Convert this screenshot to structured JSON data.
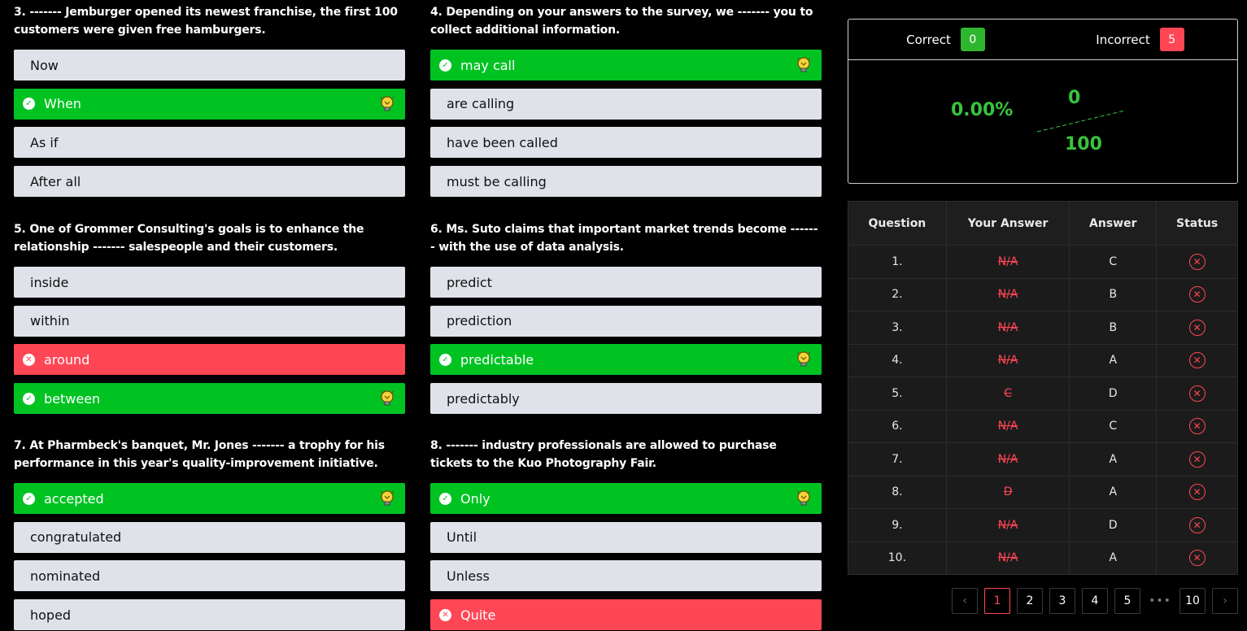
{
  "questions": [
    {
      "text": "3. ------- Jemburger opened its newest franchise, the first 100 customers were given free hamburgers.",
      "options": [
        {
          "label": "Now",
          "state": "normal",
          "hint": false
        },
        {
          "label": "When",
          "state": "correct",
          "hint": true
        },
        {
          "label": "As if",
          "state": "normal",
          "hint": false
        },
        {
          "label": "After all",
          "state": "normal",
          "hint": false
        }
      ]
    },
    {
      "text": "4. Depending on your answers to the survey, we ------- you to collect additional information.",
      "options": [
        {
          "label": "may call",
          "state": "correct",
          "hint": true
        },
        {
          "label": "are calling",
          "state": "normal",
          "hint": false
        },
        {
          "label": "have been called",
          "state": "normal",
          "hint": false
        },
        {
          "label": "must be calling",
          "state": "normal",
          "hint": false
        }
      ]
    },
    {
      "text": "5. One of Grommer Consulting's goals is to enhance the relationship ------- salespeople and their customers.",
      "options": [
        {
          "label": "inside",
          "state": "normal",
          "hint": false
        },
        {
          "label": "within",
          "state": "normal",
          "hint": false
        },
        {
          "label": "around",
          "state": "wrong",
          "hint": false
        },
        {
          "label": "between",
          "state": "correct",
          "hint": true
        }
      ]
    },
    {
      "text": "6. Ms. Suto claims that important market trends become ------- with the use of data analysis.",
      "options": [
        {
          "label": "predict",
          "state": "normal",
          "hint": false
        },
        {
          "label": "prediction",
          "state": "normal",
          "hint": false
        },
        {
          "label": "predictable",
          "state": "correct",
          "hint": true
        },
        {
          "label": "predictably",
          "state": "normal",
          "hint": false
        }
      ]
    },
    {
      "text": "7. At Pharmbeck's banquet, Mr. Jones ------- a trophy for his performance in this year's quality-improvement initiative.",
      "options": [
        {
          "label": "accepted",
          "state": "correct",
          "hint": true
        },
        {
          "label": "congratulated",
          "state": "normal",
          "hint": false
        },
        {
          "label": "nominated",
          "state": "normal",
          "hint": false
        },
        {
          "label": "hoped",
          "state": "normal",
          "hint": false
        }
      ]
    },
    {
      "text": "8. ------- industry professionals are allowed to purchase tickets to the Kuo Photography Fair.",
      "options": [
        {
          "label": "Only",
          "state": "correct",
          "hint": true
        },
        {
          "label": "Until",
          "state": "normal",
          "hint": false
        },
        {
          "label": "Unless",
          "state": "normal",
          "hint": false
        },
        {
          "label": "Quite",
          "state": "wrong",
          "hint": false
        }
      ]
    }
  ],
  "score": {
    "correct_label": "Correct",
    "correct_count": "0",
    "incorrect_label": "Incorrect",
    "incorrect_count": "5",
    "percent": "0.00%",
    "numerator": "0",
    "denominator": "100"
  },
  "table": {
    "headers": [
      "Question",
      "Your Answer",
      "Answer",
      "Status"
    ],
    "rows": [
      {
        "q": "1.",
        "yours": "N/A",
        "answer": "C"
      },
      {
        "q": "2.",
        "yours": "N/A",
        "answer": "B"
      },
      {
        "q": "3.",
        "yours": "N/A",
        "answer": "B"
      },
      {
        "q": "4.",
        "yours": "N/A",
        "answer": "A"
      },
      {
        "q": "5.",
        "yours": "C",
        "answer": "D"
      },
      {
        "q": "6.",
        "yours": "N/A",
        "answer": "C"
      },
      {
        "q": "7.",
        "yours": "N/A",
        "answer": "A"
      },
      {
        "q": "8.",
        "yours": "D",
        "answer": "A"
      },
      {
        "q": "9.",
        "yours": "N/A",
        "answer": "D"
      },
      {
        "q": "10.",
        "yours": "N/A",
        "answer": "A"
      }
    ],
    "status_icon": "x-circle-icon"
  },
  "pagination": {
    "prev": "‹",
    "pages": [
      "1",
      "2",
      "3",
      "4",
      "5"
    ],
    "dots": "•••",
    "last": "10",
    "next": "›",
    "active": "1"
  },
  "icons": {
    "check": "check-circle-icon",
    "wrong": "x-circle-icon",
    "hint": "lightbulb-icon"
  },
  "colors": {
    "correct": "#00c322",
    "wrong": "#ff4655",
    "option": "#dfe3e9",
    "background": "#000000"
  }
}
